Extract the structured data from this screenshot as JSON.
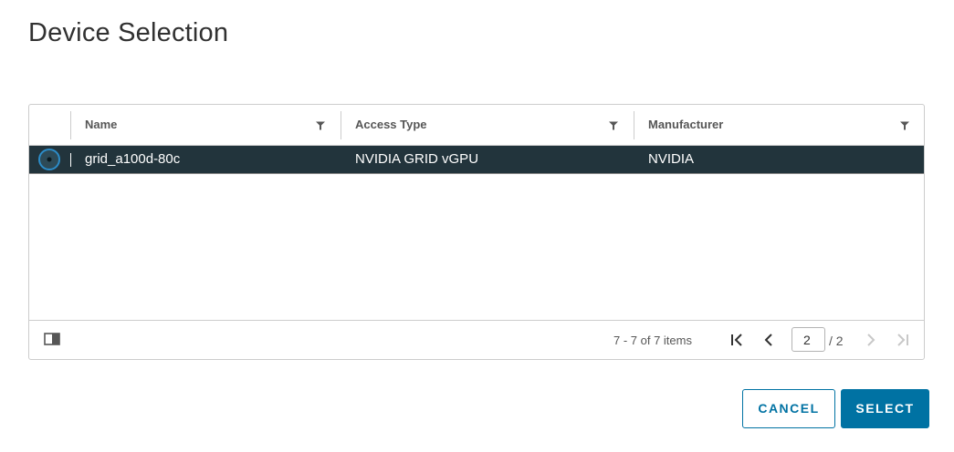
{
  "dialog": {
    "title": "Device Selection"
  },
  "grid": {
    "columns": [
      {
        "label": "Name"
      },
      {
        "label": "Access Type"
      },
      {
        "label": "Manufacturer"
      }
    ],
    "rows": [
      {
        "selected": true,
        "name": "grid_a100d-80c",
        "access_type": "NVIDIA GRID vGPU",
        "manufacturer": "NVIDIA"
      }
    ],
    "footer": {
      "items_text": "7 - 7 of 7 items",
      "current_page": "2",
      "total_pages": "/ 2"
    }
  },
  "actions": {
    "cancel_label": "CANCEL",
    "select_label": "SELECT"
  },
  "colors": {
    "accent": "#0072a3",
    "selected_row": "#22343c"
  },
  "icons": {
    "filter": "filter-icon",
    "column_toggle": "column-toggle-icon",
    "first_page": "first-page-icon",
    "prev_page": "prev-page-icon",
    "next_page": "next-page-icon",
    "last_page": "last-page-icon"
  }
}
